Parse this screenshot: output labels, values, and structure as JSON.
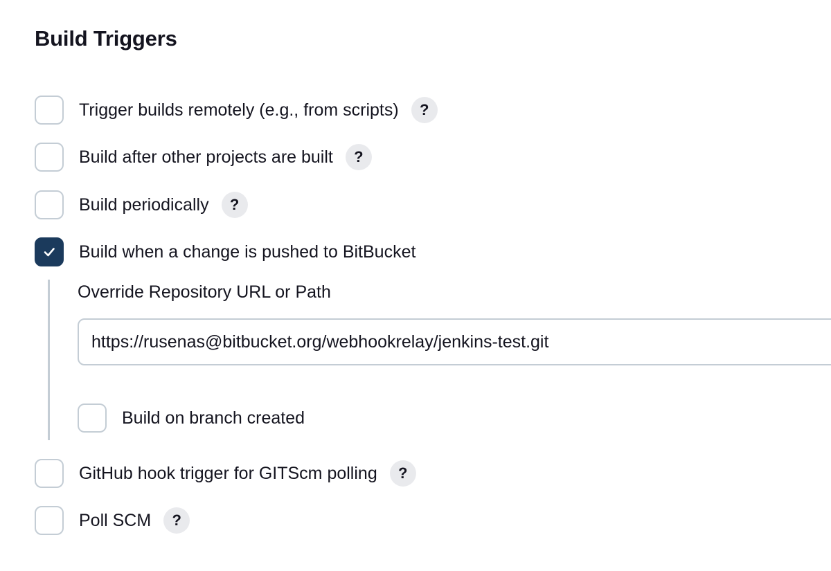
{
  "section": {
    "title": "Build Triggers"
  },
  "triggers": [
    {
      "label": "Trigger builds remotely (e.g., from scripts)",
      "checked": false,
      "help": "?"
    },
    {
      "label": "Build after other projects are built",
      "checked": false,
      "help": "?"
    },
    {
      "label": "Build periodically",
      "checked": false,
      "help": "?"
    },
    {
      "label": "Build when a change is pushed to BitBucket",
      "checked": true
    },
    {
      "label": "GitHub hook trigger for GITScm polling",
      "checked": false,
      "help": "?"
    },
    {
      "label": "Poll SCM",
      "checked": false,
      "help": "?"
    }
  ],
  "bitbucket": {
    "field_label": "Override Repository URL or Path",
    "url_value": "https://rusenas@bitbucket.org/webhookrelay/jenkins-test.git",
    "branch_label": "Build on branch created",
    "branch_checked": false
  },
  "colors": {
    "checked_fill": "#1b3a5c",
    "border": "#c4cdd5",
    "help_bg": "#e9eaed"
  },
  "icons": {
    "check": "checkmark-icon",
    "help": "help-icon"
  }
}
